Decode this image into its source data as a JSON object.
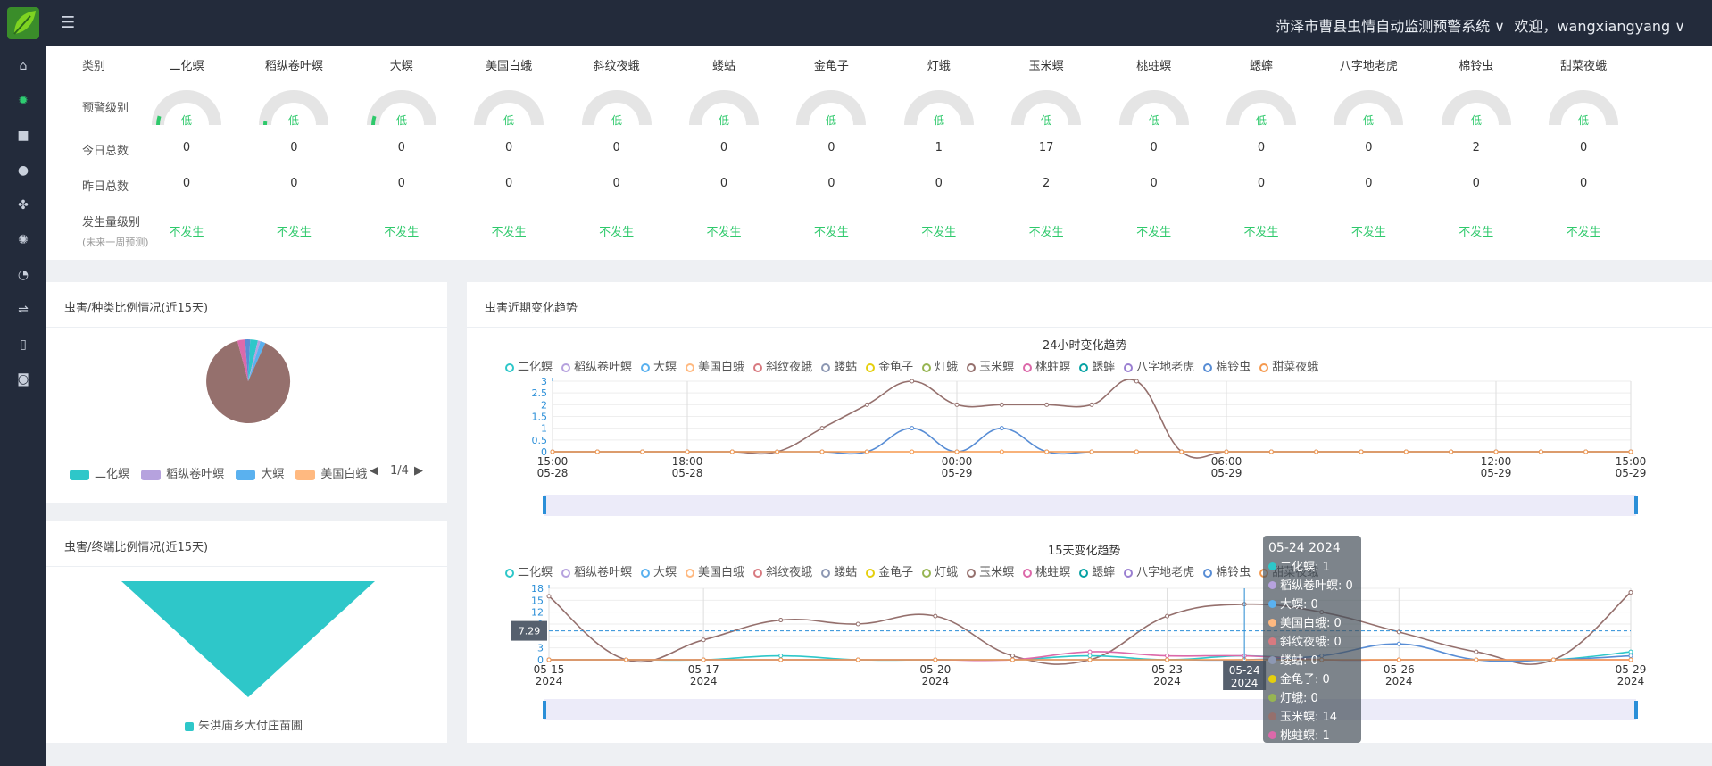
{
  "header": {
    "system_title": "菏泽市曹县虫情自动监测预警系统 ∨",
    "welcome": "欢迎，wangxiangyang ∨",
    "menu_toggle": "☰"
  },
  "sidebar": {
    "items": [
      "home-icon",
      "insect-icon",
      "camera-icon",
      "water-drop-icon",
      "bacteria-icon",
      "alarm-icon",
      "gauge-icon",
      "cable-icon",
      "book-icon",
      "camera-alt-icon"
    ],
    "active_index": 1
  },
  "table": {
    "row_labels": {
      "category": "类别",
      "warning_level": "预警级别",
      "today_total": "今日总数",
      "yesterday_total": "昨日总数",
      "occurrence_level": "发生量级别",
      "occurrence_sub": "(未来一周预测)"
    },
    "gauge_label": "低",
    "columns": [
      {
        "name": "二化螟",
        "today": "0",
        "yesterday": "0",
        "level": "不发生",
        "gauge_fill": 0.1
      },
      {
        "name": "稻纵卷叶螟",
        "today": "0",
        "yesterday": "0",
        "level": "不发生",
        "gauge_fill": 0.04
      },
      {
        "name": "大螟",
        "today": "0",
        "yesterday": "0",
        "level": "不发生",
        "gauge_fill": 0.1
      },
      {
        "name": "美国白蛾",
        "today": "0",
        "yesterday": "0",
        "level": "不发生",
        "gauge_fill": 0
      },
      {
        "name": "斜纹夜蛾",
        "today": "0",
        "yesterday": "0",
        "level": "不发生",
        "gauge_fill": 0
      },
      {
        "name": "蝼蛄",
        "today": "0",
        "yesterday": "0",
        "level": "不发生",
        "gauge_fill": 0
      },
      {
        "name": "金龟子",
        "today": "0",
        "yesterday": "0",
        "level": "不发生",
        "gauge_fill": 0
      },
      {
        "name": "灯蛾",
        "today": "1",
        "yesterday": "0",
        "level": "不发生",
        "gauge_fill": 0
      },
      {
        "name": "玉米螟",
        "today": "17",
        "yesterday": "2",
        "level": "不发生",
        "gauge_fill": 0
      },
      {
        "name": "桃蛀螟",
        "today": "0",
        "yesterday": "0",
        "level": "不发生",
        "gauge_fill": 0
      },
      {
        "name": "蟋蟀",
        "today": "0",
        "yesterday": "0",
        "level": "不发生",
        "gauge_fill": 0
      },
      {
        "name": "八字地老虎",
        "today": "0",
        "yesterday": "0",
        "level": "不发生",
        "gauge_fill": 0
      },
      {
        "name": "棉铃虫",
        "today": "2",
        "yesterday": "0",
        "level": "不发生",
        "gauge_fill": 0
      },
      {
        "name": "甜菜夜蛾",
        "today": "0",
        "yesterday": "0",
        "level": "不发生",
        "gauge_fill": 0
      }
    ]
  },
  "colors": {
    "green": "#2ec96b",
    "gauge_bg": "#e5e5e5",
    "series": [
      "#2ec7c9",
      "#b6a2de",
      "#5ab1ef",
      "#ffb980",
      "#d87a80",
      "#8d98b3",
      "#e5cf0d",
      "#97b552",
      "#95706d",
      "#dc69aa",
      "#07a2a4",
      "#9a7fd1",
      "#588dd5",
      "#f5994e"
    ]
  },
  "species_card": {
    "title": "虫害/种类比例情况(近15天)",
    "pager": "1/4",
    "legend": [
      "二化螟",
      "稻纵卷叶螟",
      "大螟",
      "美国白蛾"
    ]
  },
  "terminal_card": {
    "title": "虫害/终端比例情况(近15天)",
    "legend": [
      "朱洪庙乡大付庄苗圃"
    ]
  },
  "trend_card": {
    "title": "虫害近期变化趋势"
  },
  "series_names": [
    "二化螟",
    "稻纵卷叶螟",
    "大螟",
    "美国白蛾",
    "斜纹夜蛾",
    "蝼蛄",
    "金龟子",
    "灯蛾",
    "玉米螟",
    "桃蛀螟",
    "蟋蟀",
    "八字地老虎",
    "棉铃虫",
    "甜菜夜蛾"
  ],
  "tooltip": {
    "date": "05-24 2024",
    "rows": [
      {
        "label": "二化螟: 1",
        "color": "#2ec7c9"
      },
      {
        "label": "稻纵卷叶螟: 0",
        "color": "#b6a2de"
      },
      {
        "label": "大螟: 0",
        "color": "#5ab1ef"
      },
      {
        "label": "美国白蛾: 0",
        "color": "#ffb980"
      },
      {
        "label": "斜纹夜蛾: 0",
        "color": "#d87a80"
      },
      {
        "label": "蝼蛄: 0",
        "color": "#8d98b3"
      },
      {
        "label": "金龟子: 0",
        "color": "#e5cf0d"
      },
      {
        "label": "灯蛾: 0",
        "color": "#97b552"
      },
      {
        "label": "玉米螟: 14",
        "color": "#95706d"
      },
      {
        "label": "桃蛀螟: 1",
        "color": "#dc69aa"
      }
    ]
  },
  "chart_data": [
    {
      "type": "pie",
      "title": "",
      "categories": [
        "二化螟",
        "稻纵卷叶螟",
        "大螟",
        "美国白蛾",
        "斜纹夜蛾",
        "玉米螟",
        "桃蛀螟",
        "棉铃虫"
      ],
      "values": [
        3,
        1,
        2,
        0,
        0,
        90,
        3,
        2
      ]
    },
    {
      "type": "funnel",
      "title": "",
      "categories": [
        "朱洪庙乡大付庄苗圃"
      ],
      "values": [
        100
      ]
    },
    {
      "type": "line",
      "title": "24小时变化趋势",
      "x": [
        "15:00\n05-28",
        "16:00",
        "17:00",
        "18:00\n05-28",
        "19:00",
        "20:00",
        "21:00",
        "22:00",
        "23:00",
        "00:00\n05-29",
        "01:00",
        "02:00",
        "03:00",
        "04:00",
        "05:00",
        "06:00\n05-29",
        "07:00",
        "08:00",
        "09:00",
        "10:00",
        "11:00",
        "12:00\n05-29",
        "13:00",
        "14:00",
        "15:00\n05-29"
      ],
      "x_ticks": [
        "15:00\n05-28",
        "18:00\n05-28",
        "00:00\n05-29",
        "06:00\n05-29",
        "12:00\n05-29",
        "15:00\n05-29"
      ],
      "y_ticks": [
        "0",
        "0.5",
        "1",
        "1.5",
        "2",
        "2.5",
        "3"
      ],
      "ylim": [
        0,
        3
      ],
      "series": [
        {
          "name": "玉米螟",
          "values": [
            0,
            0,
            0,
            0,
            0,
            0,
            1,
            2,
            3,
            2,
            2,
            2,
            2,
            3,
            0,
            0,
            0,
            0,
            0,
            0,
            0,
            0,
            0,
            0,
            0
          ]
        },
        {
          "name": "棉铃虫",
          "values": [
            0,
            0,
            0,
            0,
            0,
            0,
            0,
            0,
            1,
            0,
            1,
            0,
            0,
            0,
            0,
            0,
            0,
            0,
            0,
            0,
            0,
            0,
            0,
            0,
            0
          ]
        },
        {
          "name": "甜菜夜蛾",
          "values": [
            0,
            0,
            0,
            0,
            0,
            0,
            0,
            0,
            0,
            0,
            0,
            0,
            0,
            0,
            0,
            0,
            0,
            0,
            0,
            0,
            0,
            0,
            0,
            0,
            0
          ]
        }
      ]
    },
    {
      "type": "line",
      "title": "15天变化趋势",
      "x": [
        "05-15\n2024",
        "05-16",
        "05-17\n2024",
        "05-18",
        "05-19",
        "05-20\n2024",
        "05-21",
        "05-22",
        "05-23\n2024",
        "05-24\n2024",
        "05-25",
        "05-26\n2024",
        "05-27",
        "05-28",
        "05-29\n2024"
      ],
      "x_ticks": [
        "05-15\n2024",
        "05-17\n2024",
        "05-20\n2024",
        "05-23\n2024",
        "05-24\n2024",
        "05-26\n2024",
        "05-29\n2024"
      ],
      "y_ticks": [
        "0",
        "3",
        "6",
        "9",
        "12",
        "15",
        "18"
      ],
      "ylim": [
        0,
        18
      ],
      "marker_line": "7.29",
      "series": [
        {
          "name": "玉米螟",
          "values": [
            16,
            0,
            5,
            10,
            9,
            11,
            1,
            0,
            11,
            14,
            12,
            7,
            2,
            0,
            17
          ]
        },
        {
          "name": "二化螟",
          "values": [
            0,
            0,
            0,
            1,
            0,
            0,
            0,
            1,
            0,
            1,
            0,
            0,
            0,
            0,
            2
          ]
        },
        {
          "name": "桃蛀螟",
          "values": [
            0,
            0,
            0,
            0,
            0,
            0,
            0,
            2,
            1,
            1,
            0,
            0,
            0,
            0,
            0
          ]
        },
        {
          "name": "棉铃虫",
          "values": [
            0,
            0,
            0,
            0,
            0,
            0,
            0,
            0,
            0,
            0,
            1,
            4,
            0,
            0,
            1
          ]
        },
        {
          "name": "甜菜夜蛾",
          "values": [
            0,
            0,
            0,
            0,
            0,
            0,
            0,
            0,
            0,
            0,
            0,
            0,
            0,
            0,
            0
          ]
        }
      ]
    }
  ]
}
